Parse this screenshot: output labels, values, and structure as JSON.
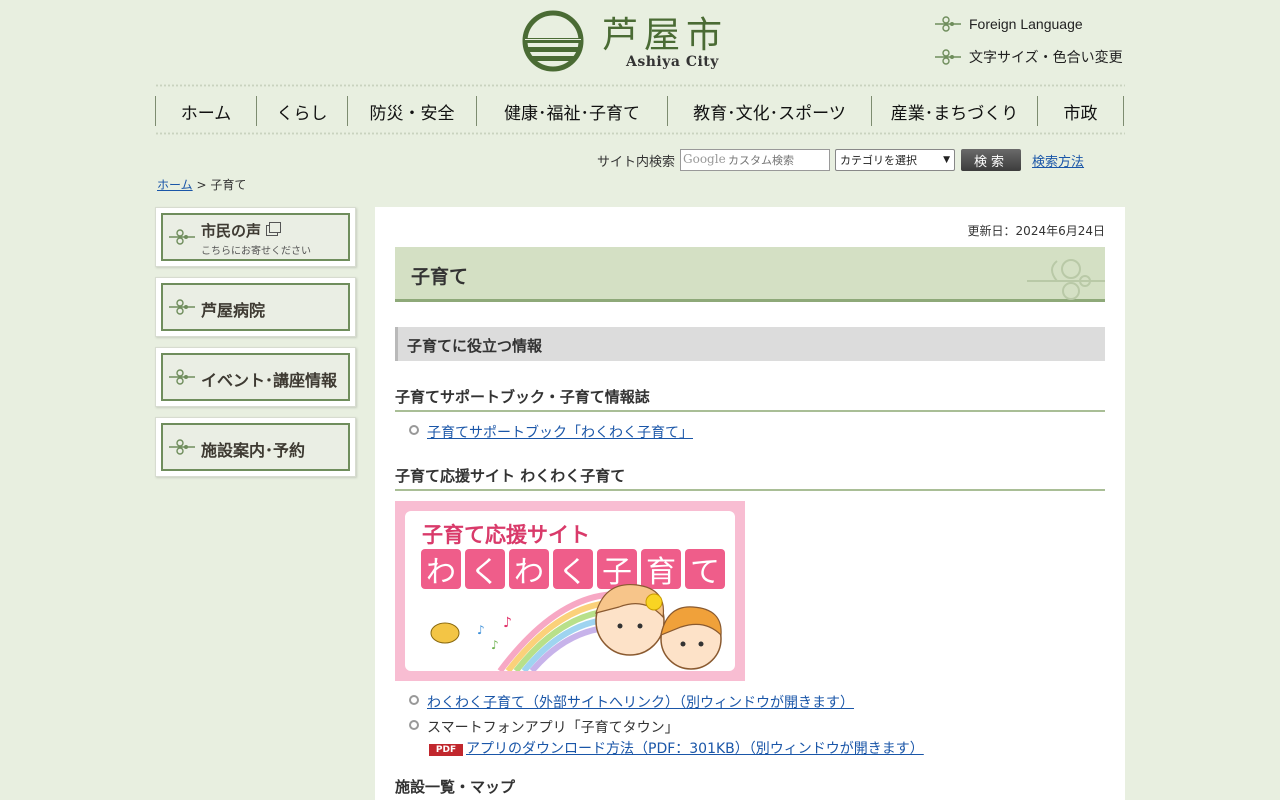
{
  "header": {
    "logo_ja": "芦屋市",
    "logo_en": "Ashiya City",
    "util_links": [
      "Foreign Language",
      "文字サイズ・色合い変更"
    ]
  },
  "nav": {
    "items": [
      "ホーム",
      "くらし",
      "防災・安全",
      "健康･福祉･子育て",
      "教育･文化･スポーツ",
      "産業･まちづくり",
      "市政"
    ]
  },
  "search": {
    "label": "サイト内検索",
    "placeholder": "カスタム検索",
    "google_text": "Google",
    "category_selected": "カテゴリを選択",
    "button": "検索",
    "how_link": "検索方法"
  },
  "breadcrumb": {
    "home": "ホーム",
    "sep": " > ",
    "current": "子育て"
  },
  "side": {
    "banners": [
      {
        "title": "市民の声",
        "sub": "こちらにお寄せください"
      },
      {
        "title": "芦屋病院"
      },
      {
        "title": "イベント･講座情報"
      },
      {
        "title": "施設案内･予約"
      }
    ]
  },
  "main": {
    "updated": "更新日：2024年6月24日",
    "page_title": "子育て",
    "section_title": "子育てに役立つ情報",
    "h3_1": "子育てサポートブック・子育て情報誌",
    "link_1": "子育てサポートブック「わくわく子育て」",
    "h3_2": "子育て応援サイト わくわく子育て",
    "banner_line1": "子育て応援サイト",
    "banner_chars": [
      "わ",
      "く",
      "わ",
      "く",
      "子",
      "育",
      "て"
    ],
    "link_2": "わくわく子育て（外部サイトへリンク）（別ウィンドウが開きます）",
    "app_text": "スマートフォンアプリ「子育てタウン」",
    "pdf_badge": "PDF",
    "link_3": "アプリのダウンロード方法（PDF：301KB）（別ウィンドウが開きます）",
    "h3_3": "施設一覧・マップ"
  },
  "colors": {
    "background": "#e8efe0",
    "brand_green": "#4a6b34",
    "link": "#1a56a8",
    "banner_pink": "#ef5d8a"
  }
}
